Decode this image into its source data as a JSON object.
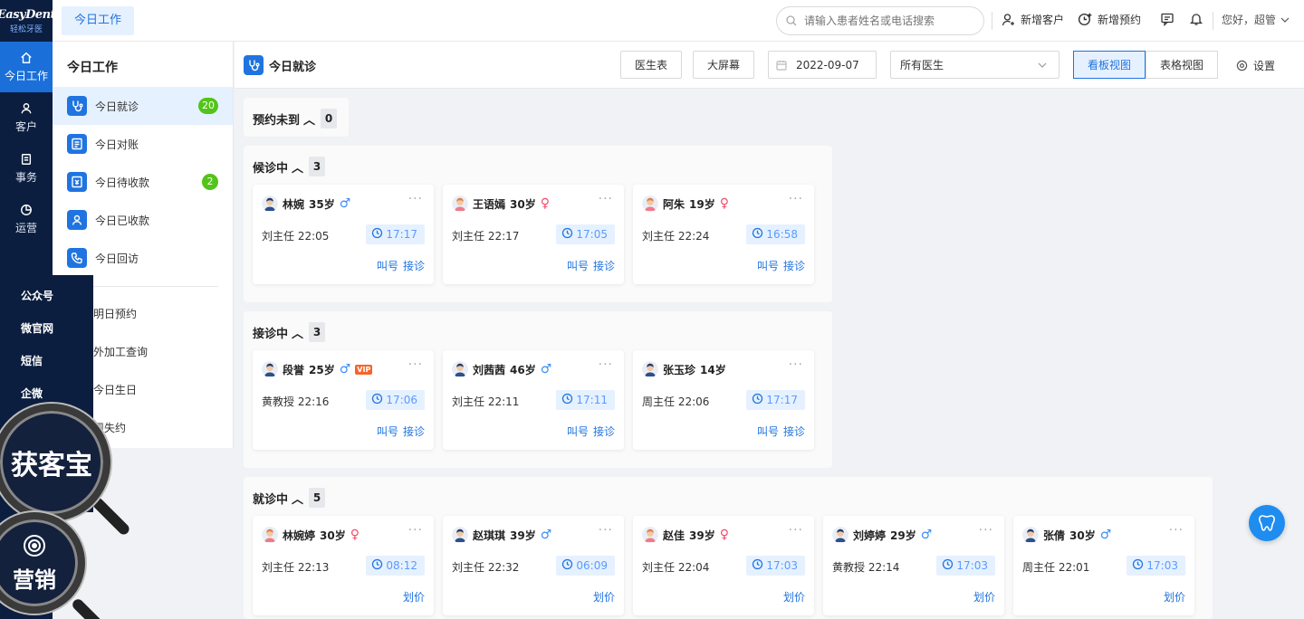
{
  "brand": {
    "name_en": "EasyDent",
    "name_cn": "轻松牙医"
  },
  "rail": [
    {
      "label": "今日工作",
      "icon": "home-icon"
    },
    {
      "label": "客户",
      "icon": "user-icon"
    },
    {
      "label": "事务",
      "icon": "document-icon"
    },
    {
      "label": "运营",
      "icon": "pie-chart-icon"
    }
  ],
  "flyout": [
    "公众号",
    "微官网",
    "短信",
    "企微"
  ],
  "magnifier": {
    "top_label": "获客宝",
    "bottom_label": "营销"
  },
  "topbar": {
    "tab": "今日工作",
    "search_placeholder": "请输入患者姓名或电话搜索",
    "new_customer": "新增客户",
    "new_appointment": "新增预约",
    "greeting": "您好，超管"
  },
  "subnav": {
    "title": "今日工作",
    "items": [
      {
        "label": "今日就诊",
        "badge": "20"
      },
      {
        "label": "今日对账",
        "badge": ""
      },
      {
        "label": "今日待收款",
        "badge": "2"
      },
      {
        "label": "今日已收款",
        "badge": ""
      },
      {
        "label": "今日回访",
        "badge": ""
      }
    ],
    "plain_items": [
      "明日预约",
      "外加工查询",
      "今日生日",
      "周失约"
    ]
  },
  "main": {
    "title": "今日就诊",
    "doctor_table": "医生表",
    "big_screen": "大屏幕",
    "date": "2022-09-07",
    "doctor_select": "所有医生",
    "kanban_view": "看板视图",
    "table_view": "表格视图",
    "settings": "设置"
  },
  "sections": [
    {
      "title": "预约未到",
      "count": "0",
      "cards": []
    },
    {
      "title": "候诊中",
      "count": "3",
      "cards": [
        {
          "name": "林婉",
          "age": "35岁",
          "gender": "male",
          "doctor": "刘主任 22:05",
          "time": "17:17",
          "actions": [
            "叫号",
            "接诊"
          ],
          "vip": false
        },
        {
          "name": "王语嫣",
          "age": "30岁",
          "gender": "female",
          "doctor": "刘主任 22:17",
          "time": "17:05",
          "actions": [
            "叫号",
            "接诊"
          ],
          "vip": false
        },
        {
          "name": "阿朱",
          "age": "19岁",
          "gender": "female",
          "doctor": "刘主任 22:24",
          "time": "16:58",
          "actions": [
            "叫号",
            "接诊"
          ],
          "vip": false
        }
      ]
    },
    {
      "title": "接诊中",
      "count": "3",
      "cards": [
        {
          "name": "段誉",
          "age": "25岁",
          "gender": "male",
          "doctor": "黄教授 22:16",
          "time": "17:06",
          "actions": [
            "叫号",
            "接诊"
          ],
          "vip": true
        },
        {
          "name": "刘茜茜",
          "age": "46岁",
          "gender": "male",
          "doctor": "刘主任 22:11",
          "time": "17:11",
          "actions": [
            "叫号",
            "接诊"
          ],
          "vip": false
        },
        {
          "name": "张玉珍",
          "age": "14岁",
          "gender": "none",
          "doctor": "周主任 22:06",
          "time": "17:17",
          "actions": [
            "叫号",
            "接诊"
          ],
          "vip": false
        }
      ]
    },
    {
      "title": "就诊中",
      "count": "5",
      "cards": [
        {
          "name": "林婉婷",
          "age": "30岁",
          "gender": "female",
          "doctor": "刘主任 22:13",
          "time": "08:12",
          "actions": [
            "划价"
          ],
          "vip": false
        },
        {
          "name": "赵琪琪",
          "age": "39岁",
          "gender": "male",
          "doctor": "刘主任 22:32",
          "time": "06:09",
          "actions": [
            "划价"
          ],
          "vip": false
        },
        {
          "name": "赵佳",
          "age": "39岁",
          "gender": "female",
          "doctor": "刘主任 22:04",
          "time": "17:03",
          "actions": [
            "划价"
          ],
          "vip": false
        },
        {
          "name": "刘婷婷",
          "age": "29岁",
          "gender": "male",
          "doctor": "黄教授 22:14",
          "time": "17:03",
          "actions": [
            "划价"
          ],
          "vip": false
        },
        {
          "name": "张倩",
          "age": "30岁",
          "gender": "male",
          "doctor": "周主任 22:01",
          "time": "17:03",
          "actions": [
            "划价"
          ],
          "vip": false
        }
      ]
    }
  ],
  "symbols": {
    "male": "♂",
    "female": "♀",
    "vip": "VIP",
    "more": "···",
    "collapse": "︿"
  },
  "colors": {
    "primary": "#1f74e0",
    "rail": "#0b1e3f",
    "badge": "#52c41a",
    "male": "#3b8df5",
    "female": "#f24a6c"
  }
}
